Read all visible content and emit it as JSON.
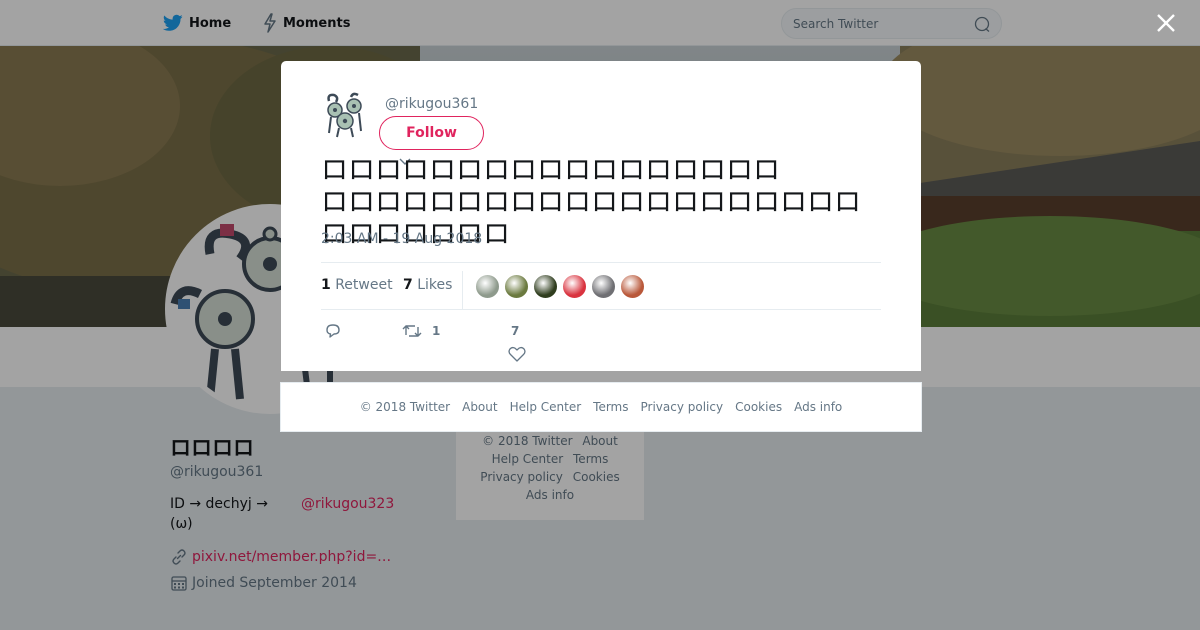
{
  "topbar": {
    "home_label": "Home",
    "moments_label": "Moments",
    "search_placeholder": "Search Twitter",
    "icons": {
      "home": "bird-icon",
      "moments": "lightning-icon",
      "search": "search-icon"
    }
  },
  "profile": {
    "name": "ロロロロ",
    "handle": "@rikugou361",
    "bio_line1": "ID → dechyj  →",
    "bio_line2": "(ω)",
    "bio_mention": "@rikugou323",
    "link_text": "pixiv.net/member.php?id=…",
    "joined": "Joined September 2014",
    "accent_color": "#e0245e"
  },
  "side_footer": {
    "items": [
      "© 2018 Twitter",
      "About",
      "Help Center",
      "Terms",
      "Privacy policy",
      "Cookies",
      "Ads info"
    ]
  },
  "tweet": {
    "handle": "@rikugou361",
    "follow_label": "Follow",
    "text_line1": "ロロロロロロロロロロロロロロロロロ",
    "text_line2": "ロロロロロロロロロロロロロロロロロロロロロロロロロロロ",
    "timestamp": "2:03 AM - 19 Aug 2018",
    "retweet_count": "1",
    "retweet_label": "Retweet",
    "like_count": "7",
    "like_label": "Likes",
    "action_retweet_count": "1",
    "action_like_count": "7",
    "liker_colors": [
      "#8e9a8c",
      "#6b7a3f",
      "#2f3d1e",
      "#d9333f",
      "#6f6f73",
      "#b9583a"
    ]
  },
  "footer": {
    "items": [
      "© 2018 Twitter",
      "About",
      "Help Center",
      "Terms",
      "Privacy policy",
      "Cookies",
      "Ads info"
    ]
  }
}
